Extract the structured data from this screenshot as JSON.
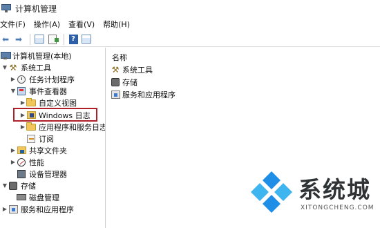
{
  "window": {
    "title": "计算机管理"
  },
  "menu": {
    "items": [
      "文件(F)",
      "操作(A)",
      "查看(V)",
      "帮助(H)"
    ]
  },
  "toolbar": {
    "buttons": [
      "back-arrow",
      "forward-arrow",
      "console-tree",
      "properties",
      "help",
      "show-hide"
    ]
  },
  "tree": {
    "root": "计算机管理(本地)",
    "system_tools": "系统工具",
    "task_scheduler": "任务计划程序",
    "event_viewer": "事件查看器",
    "custom_views": "自定义视图",
    "windows_logs": "Windows 日志",
    "app_service_logs": "应用程序和服务日志",
    "subscriptions": "订阅",
    "shared_folders": "共享文件夹",
    "performance": "性能",
    "device_manager": "设备管理器",
    "storage": "存储",
    "disk_management": "磁盘管理",
    "services_apps": "服务和应用程序"
  },
  "content": {
    "column_name": "名称",
    "items": [
      "系统工具",
      "存储",
      "服务和应用程序"
    ]
  },
  "watermark": {
    "title": "系统城",
    "url": "XITONGCHENG.COM",
    "colors": {
      "blue": "#1f8ee6",
      "cyan": "#3fb5f0",
      "text": "#2f3336"
    }
  },
  "colors": {
    "highlight_border": "#b01f28"
  }
}
